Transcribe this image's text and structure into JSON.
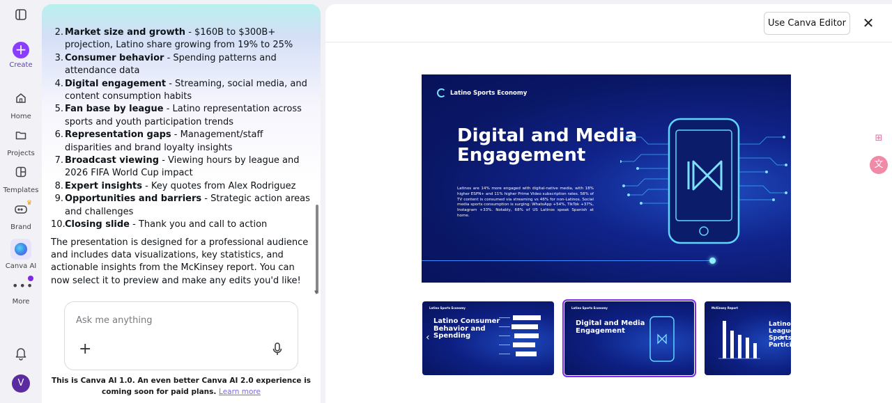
{
  "rail": {
    "create_label": "Create",
    "home_label": "Home",
    "projects_label": "Projects",
    "templates_label": "Templates",
    "brand_label": "Brand",
    "canva_ai_label": "Canva AI",
    "more_label": "More",
    "avatar_initial": "V"
  },
  "chat": {
    "items": [
      {
        "num": "2.",
        "bold": "Market size and growth",
        "rest": " - $160B to $300B+ projection, Latino share growing from 19% to 25%"
      },
      {
        "num": "3.",
        "bold": "Consumer behavior",
        "rest": " - Spending patterns and attendance data"
      },
      {
        "num": "4.",
        "bold": "Digital engagement",
        "rest": " - Streaming, social media, and content consumption habits"
      },
      {
        "num": "5.",
        "bold": "Fan base by league",
        "rest": " - Latino representation across sports and youth participation trends"
      },
      {
        "num": "6.",
        "bold": "Representation gaps",
        "rest": " - Management/staff disparities and brand loyalty insights"
      },
      {
        "num": "7.",
        "bold": "Broadcast viewing",
        "rest": " - Viewing hours by league and 2026 FIFA World Cup impact"
      },
      {
        "num": "8.",
        "bold": "Expert insights",
        "rest": " - Key quotes from Alex Rodriguez"
      },
      {
        "num": "9.",
        "bold": "Opportunities and barriers",
        "rest": " - Strategic action areas and challenges"
      },
      {
        "num": "10.",
        "bold": "Closing slide",
        "rest": " - Thank you and call to action"
      }
    ],
    "summary": "The presentation is designed for a professional audience and includes data visualizations, key statistics, and actionable insights from the McKinsey report. You can now select it to preview and make any edits you'd like!",
    "input_placeholder": "Ask me anything",
    "footnote": "This is Canva AI 1.0. An even better Canva AI 2.0 experience is coming soon for paid plans.",
    "learn_more": "Learn more"
  },
  "preview": {
    "use_editor_label": "Use Canva Editor",
    "close_glyph": "✕",
    "slide": {
      "brand": "Latino Sports Economy",
      "title": "Digital and Media Engagement",
      "body": "Latinos are 14% more engaged with digital-native media, with 18% higher ESPN+ and 11% higher Prime Video subscription rates. 58% of TV content is consumed via streaming vs 46% for non-Latinos. Social media sports consumption is surging: WhatsApp +54%, TikTok +37%, Instagram +33%. Notably, 68% of US Latinos speak Spanish at home."
    },
    "thumbnails": [
      {
        "brand": "Latino Sports Economy",
        "title": "Latino Consumer Behavior and Spending"
      },
      {
        "brand": "Latino Sports Economy",
        "title": "Digital and Media Engagement"
      },
      {
        "brand": "McKinsey Report",
        "title": "Latino League Sports Particip..."
      }
    ]
  },
  "colors": {
    "accent": "#8b3dff",
    "slide_bg": "#0a1766",
    "link": "#7a6cd8"
  }
}
